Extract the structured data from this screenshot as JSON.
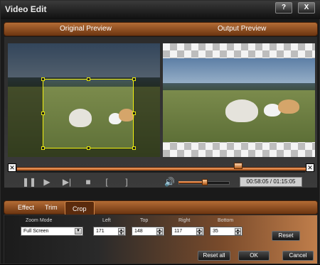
{
  "window": {
    "title": "Video Edit",
    "help_label": "?",
    "close_label": "X"
  },
  "preview": {
    "original_label": "Original Preview",
    "output_label": "Output Preview"
  },
  "timeline": {
    "start_marker": "✕",
    "end_marker": "✕",
    "position": 0.76
  },
  "controls": {
    "time_readout": "00:58:05 / 01:15:05",
    "icons": [
      "pause-icon",
      "play-icon",
      "next-frame-icon",
      "stop-icon",
      "mark-in-icon",
      "mark-out-icon",
      "volume-icon"
    ],
    "volume": 0.5
  },
  "tabs": [
    {
      "label": "Effect"
    },
    {
      "label": "Trim"
    },
    {
      "label": "Crop"
    }
  ],
  "crop": {
    "zoom_mode_label": "Zoom Mode",
    "zoom_mode_value": "Full Screen",
    "left_label": "Left",
    "left_value": "171",
    "top_label": "Top",
    "top_value": "148",
    "right_label": "Right",
    "right_value": "117",
    "bottom_label": "Bottom",
    "bottom_value": "35",
    "reset_label": "Reset"
  },
  "footer": {
    "reset_all_label": "Reset all",
    "ok_label": "OK",
    "cancel_label": "Cancel"
  },
  "colors": {
    "accent": "#b46c35",
    "crop_frame": "#f1f10f"
  }
}
